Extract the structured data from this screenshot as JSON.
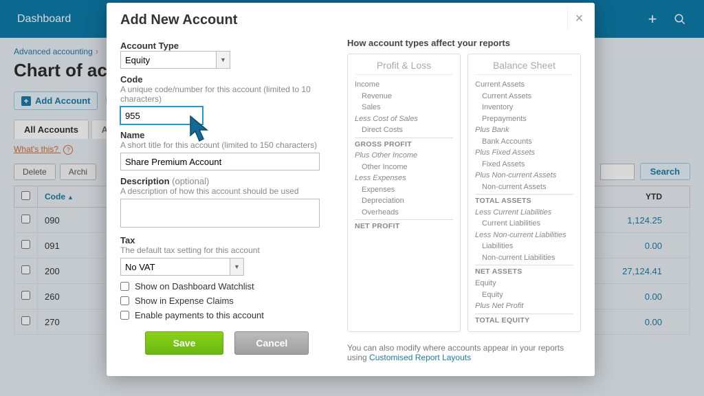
{
  "header": {
    "dashboard": "Dashboard"
  },
  "breadcrumb": {
    "parent": "Advanced accounting"
  },
  "page": {
    "title": "Chart of ac"
  },
  "buttons": {
    "add_account": "Add Account",
    "search": "Search",
    "delete": "Delete",
    "archive": "Archi"
  },
  "tabs": {
    "all_accounts": "All Accounts",
    "next": "A"
  },
  "whats_this": "What's this?",
  "table": {
    "headers": {
      "code": "Code",
      "ytd": "YTD"
    },
    "rows": [
      {
        "code": "090",
        "ytd": "1,124.25"
      },
      {
        "code": "091",
        "ytd": "0.00"
      },
      {
        "code": "200",
        "ytd": "27,124.41"
      },
      {
        "code": "260",
        "ytd": "0.00"
      },
      {
        "code": "270",
        "ytd": "0.00"
      }
    ]
  },
  "modal": {
    "title": "Add New Account",
    "account_type_label": "Account Type",
    "account_type_value": "Equity",
    "code_label": "Code",
    "code_hint": "A unique code/number for this account (limited to 10 characters)",
    "code_value": "955",
    "name_label": "Name",
    "name_hint": "A short title for this account (limited to 150 characters)",
    "name_value": "Share Premium Account",
    "desc_label": "Description",
    "desc_optional": "(optional)",
    "desc_hint": "A description of how this account should be used",
    "desc_value": "",
    "tax_label": "Tax",
    "tax_hint": "The default tax setting for this account",
    "tax_value": "No VAT",
    "chk_watchlist": "Show on Dashboard Watchlist",
    "chk_expense": "Show in Expense Claims",
    "chk_payments": "Enable payments to this account",
    "save": "Save",
    "cancel": "Cancel"
  },
  "report": {
    "title": "How account types affect your reports",
    "pl_title": "Profit & Loss",
    "bs_title": "Balance Sheet",
    "pl": {
      "income": "Income",
      "revenue": "Revenue",
      "sales": "Sales",
      "less_cos": "Less Cost of Sales",
      "direct_costs": "Direct Costs",
      "gross_profit": "GROSS PROFIT",
      "plus_other": "Plus Other Income",
      "other_income": "Other Income",
      "less_exp": "Less Expenses",
      "expenses": "Expenses",
      "depreciation": "Depreciation",
      "overheads": "Overheads",
      "net_profit": "NET PROFIT"
    },
    "bs": {
      "cur_assets": "Current Assets",
      "cur_assets2": "Current Assets",
      "inventory": "Inventory",
      "prepayments": "Prepayments",
      "plus_bank": "Plus Bank",
      "bank_acc": "Bank Accounts",
      "plus_fixed": "Plus Fixed Assets",
      "fixed_assets": "Fixed Assets",
      "plus_nca": "Plus Non-current Assets",
      "nca": "Non-current Assets",
      "total_assets": "TOTAL ASSETS",
      "less_cl": "Less Current Liabilities",
      "cl": "Current Liabilities",
      "less_ncl": "Less Non-current Liabilities",
      "liab": "Liabilities",
      "ncl": "Non-current Liabilities",
      "net_assets": "NET ASSETS",
      "equity": "Equity",
      "equity2": "Equity",
      "plus_np": "Plus Net Profit",
      "total_equity": "TOTAL EQUITY"
    },
    "footer": "You can also modify where accounts appear in your reports using ",
    "footer_link": "Customised Report Layouts"
  }
}
